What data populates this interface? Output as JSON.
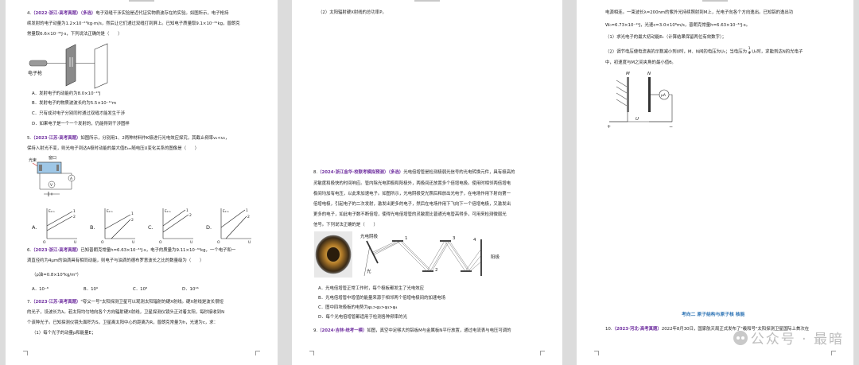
{
  "page1": {
    "q4_line1_num": "4.",
    "q4_line1_src": "（2022·浙江·高考真题）（多选）",
    "q4_line1_text": "电子双缝干涉实验是近代证实物质波存在的实验。如图所示，电子枪持",
    "q4_line2": "续发射的电子动量为1.2×10⁻²³kg·m/s，然后让它们通过双缝打到屏上。已知电子质量取9.1×10⁻³¹kg，普朗克",
    "q4_line3": "常量取6.6×10⁻³⁴J·s，下列说法正确的是（　　）",
    "q4_fig_label": "电子枪",
    "q4_A": "A．发射电子的动能约为8.0×10⁻¹⁵J",
    "q4_B": "B．发射电子的物质波波长约为5.5×10⁻¹¹m",
    "q4_C": "C．只有成对电子分别同时通过双缝才能发生干涉",
    "q4_D": "D．如果电子是一个一个发射的，仍能得到干涉图样",
    "q5_num": "5.",
    "q5_src": "（2023·江苏·高考真题）",
    "q5_text1": "如图所示，分别用1、2两种材料作K极进行光电效应探究，其截止频率ν₁<ν₂，",
    "q5_text2": "保持入射光不变，则光电子到达A极时动能的最大值Eₖₘ随电压U变化关系的图像是（　　）",
    "q5_fig_label1": "光束",
    "q5_fig_label2": "窗口",
    "q5_opt_A": "A.",
    "q5_opt_B": "B.",
    "q5_opt_C": "C.",
    "q5_opt_D": "D.",
    "q5_axis_y": "Eₖₘ",
    "q5_axis_x": "U",
    "q5_origin": "O",
    "q5_l1": "1",
    "q5_l2": "2",
    "q6_num": "6.",
    "q6_src": "（2023·浙江·高考真题）",
    "q6_text1": "已知普朗克常量h=6.63×10⁻³⁴J·s，电子的质量为9.11×10⁻³¹kg，一个电子和一",
    "q6_text2": "滴直径约为4μm的油滴具有相同动能，则电子与油滴的德布罗意波长之比的数量级为（　　）",
    "q6_text3": "（ρ油=0.8×10³kg/m³）",
    "q6_A": "A．10⁻⁸",
    "q6_B": "B．10⁶",
    "q6_C": "C．10⁸",
    "q6_D": "D．10¹⁶",
    "q7_num": "7.",
    "q7_src": "（2023·江苏·高考真题）",
    "q7_text1": "\"夸父一号\"太阳探测卫星可以观测太阳辐射的硬X射线。硬X射线是波长很短",
    "q7_text2": "的光子，设波长为λ。若太阳均匀地向各个方向辐射硬X射线，卫星探测仪镜头正对着太阳，每秒接收到N",
    "q7_text3": "个该种光子。已知探测仪镜头面积为S，卫星离太阳中心的距离为R，普朗克常量为h，光速为c，求：",
    "q7_text4": "（1）每个光子的动量p和能量E；"
  },
  "page2": {
    "top_line": "（2）太阳辐射硬X射线的总功率P。",
    "q8_num": "8.",
    "q8_src": "（2024·浙江金华·校联考模拟预测）（多选）",
    "q8_text1": "光电倍增管是检测极弱光信号的光电转换元件，具有极高的",
    "q8_text2": "灵敏度和极快的时间响应。管内除光电阴极和阳极外，两极间还放置多个倍增电极。使用时相邻两倍增电",
    "q8_text3": "极间均加有电压，以此来加速电子。如图所示，光电阴极受光照后释放出光电子，在电场作用下射向第一",
    "q8_text4": "倍增电极，引起电子的二次发射，激发出更多的电子，然后在电场作用下飞向下一个倍增电极，又激发出",
    "q8_text5": "更多的电子，如此电子数不断倍增，使得光电倍增管的灵敏度比普通光电管高得多，可用来检测微弱光",
    "q8_text6": "信号。下列说法正确的是（　　）",
    "q8_fig_label_cathode": "光电阴极",
    "q8_fig_label_anode": "阳极",
    "q8_fig_label_light": "光",
    "q8_fig_n1": "1",
    "q8_fig_n2": "2",
    "q8_fig_n3": "3",
    "q8_fig_n4": "4",
    "q8_A": "A．光电倍增管正常工作时，每个极板都发生了光电效应",
    "q8_B": "B．光电倍增管中增值的能量来源于相邻两个倍增电极间的加速电场",
    "q8_C": "C．图中四块极板的电势为φ₁>φ₂>φ₃>φ₄",
    "q8_D": "D．每个光电倍增管都适用于检测各种频率的光",
    "q9_num": "9.",
    "q9_src": "（2024·吉林·统考一模）",
    "q9_text": "如图，真空中足够大的铝板M与金属板N平行放置，通过电流表与电压可调的"
  },
  "page3": {
    "l1": "电源相连。一束波长λ=200nm的紫外光持续照射到M上，光电子向各个方向逸出。已知铝的逸出功",
    "l2": "W₀=6.73×10⁻¹⁹J，光速c=3.0×10⁸m/s，普朗克常量h=6.63×10⁻³⁴J·s。",
    "l3": "（1）求光电子的最大初动能Eₖ（计算结果保留两位有效数字）；",
    "l4a": "（2）调节电压使电流表的示数减小到0时，M、N间的电压为U₀；当电压为",
    "l4frac_num": "1",
    "l4frac_den": "4",
    "l4b": "U₀时，求能到达N的光电子",
    "l5": "中，初速度与M之间夹角的最小值θ。",
    "fig_M": "M",
    "fig_N": "N",
    "fig_meter": "μA",
    "fig_U": "U",
    "fig_plus": "+",
    "fig_minus": "−",
    "section": "考向二  原子结构与原子核  核能",
    "q10_num": "10.",
    "q10_src": "（2023·河北·高考真题）",
    "q10_text": "2022年8月30日，国家航天局正式发布了\"羲和号\"太阳探测卫星国际上首次在"
  },
  "watermark": "公众号 · 最暗"
}
